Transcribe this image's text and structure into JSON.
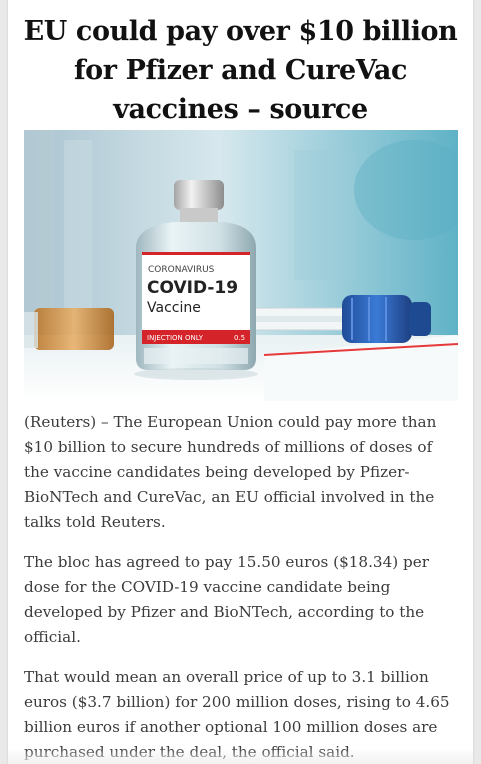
{
  "article": {
    "headline": "EU could pay over $10 billion for Pfizer and CureVac vaccines – source",
    "image": {
      "vial_label_top": "CORONAVIRUS",
      "vial_label_main": "COVID-19",
      "vial_label_sub": "Vaccine",
      "vial_label_band": "INJECTION ONLY",
      "vial_label_band_right": "0.5"
    },
    "paragraphs": [
      "(Reuters) – The European Union could pay more than $10 billion to secure hundreds of millions of doses of the vaccine candidates being developed by Pfizer-BioNTech and CureVac, an EU official involved in the talks told Reuters.",
      "The bloc has agreed to pay 15.50 euros ($18.34) per dose for the COVID-19 vaccine candidate being developed by Pfizer and BioNTech, according to the official.",
      "That would mean an overall price of up to 3.1 billion euros ($3.7 billion) for 200 million doses, rising to 4.65 billion euros if another optional 100 million doses are purchased under the deal, the official said."
    ]
  },
  "colors": {
    "headline": "#111111",
    "body_text": "#3b3b3b",
    "page_background": "#ffffff",
    "outer_background": "#e9e9e9",
    "vial_cap": "#d9d9d9",
    "label_red": "#d4242a",
    "syringe_blue": "#2a5fb3"
  }
}
